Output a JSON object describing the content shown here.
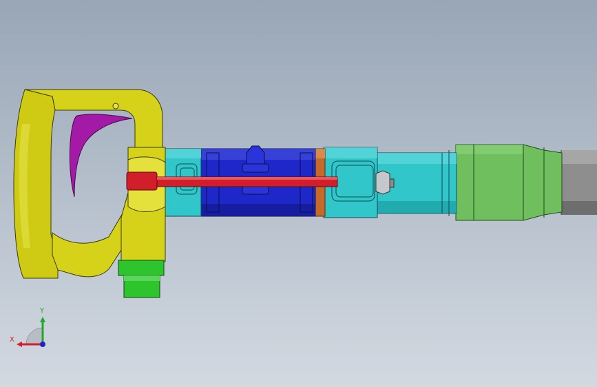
{
  "viewport": {
    "background_top": "#98a6b6",
    "background_bottom": "#d3d9e1"
  },
  "model": {
    "parts": [
      {
        "name": "handle",
        "color": "#d6d21a"
      },
      {
        "name": "trigger",
        "color": "#a21aa6"
      },
      {
        "name": "cylinder-front",
        "color": "#2ec4c8"
      },
      {
        "name": "cylinder-middle",
        "color": "#1e27c8"
      },
      {
        "name": "seal-ring",
        "color": "#c86a2a"
      },
      {
        "name": "cylinder-rear",
        "color": "#2ec4c8"
      },
      {
        "name": "barrel",
        "color": "#2ec4c8"
      },
      {
        "name": "retainer",
        "color": "#6fbf5f"
      },
      {
        "name": "chisel-shank",
        "color": "#8c8c8c"
      },
      {
        "name": "tie-rod",
        "color": "#d21e2a"
      },
      {
        "name": "air-inlet-fitting",
        "color": "#2ec42e"
      },
      {
        "name": "nut",
        "color": "#b8bcc0"
      }
    ]
  },
  "triad": {
    "x_label": "X",
    "y_label": "Y",
    "x_color": "#d2202a",
    "y_color": "#1fa82e",
    "z_color": "#2420c8"
  }
}
